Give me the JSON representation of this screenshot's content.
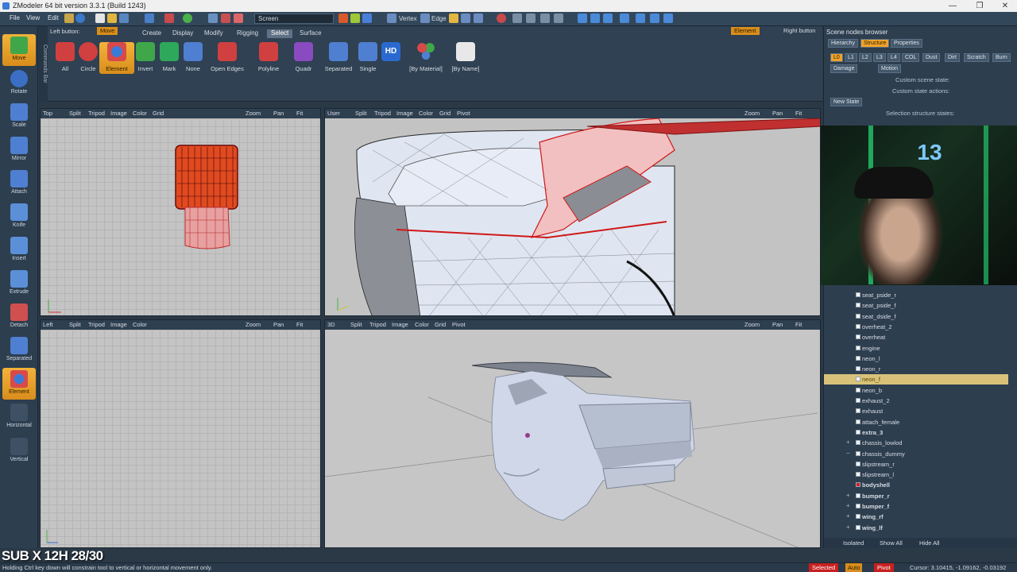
{
  "window": {
    "title": "ZModeler 64 bit version 3.3.1 (Build 1243)",
    "controls": [
      "—",
      "❐",
      "✕"
    ]
  },
  "menu": [
    "File",
    "View",
    "Edit"
  ],
  "toolbar": {
    "coord_mode": "Screen",
    "vertex": "Vertex",
    "edge": "Edge"
  },
  "left_tools": [
    "Move",
    "Rotate",
    "Scale",
    "Mirror",
    "Attach",
    "Knife",
    "Insert",
    "Extrude",
    "Detach",
    "Separated",
    "Element",
    "Horizontal",
    "Vertical"
  ],
  "left_tools_active": "Element",
  "commands_bar": "Commands Bar",
  "ribbon": {
    "left_button_label": "Left button:",
    "left_button_value": "Move",
    "tabs": [
      "Create",
      "Display",
      "Modify",
      "Rigging",
      "Select",
      "Surface"
    ],
    "selected_tab": "Select",
    "right_chip_value": "Element",
    "right_chip_label": "Right button",
    "buttons": [
      "All",
      "Circle",
      "Element",
      "Invert",
      "Mark",
      "None",
      "Open Edges",
      "Polyline",
      "Quadr",
      "Separated",
      "Single",
      "[By Material]",
      "[By Name]"
    ],
    "active_button": "Element"
  },
  "viewports": {
    "top": {
      "name": "Top",
      "tools": [
        "Split",
        "Tripod",
        "Image",
        "Color",
        "Grid"
      ],
      "nav": [
        "Zoom",
        "Pan",
        "Fit"
      ]
    },
    "user": {
      "name": "User",
      "tools": [
        "Split",
        "Tripod",
        "Image",
        "Color",
        "Grid",
        "Pivot"
      ],
      "nav": [
        "Zoom",
        "Pan",
        "Fit"
      ]
    },
    "left": {
      "name": "Left",
      "tools": [
        "Split",
        "Tripod",
        "Image",
        "Color"
      ],
      "nav": [
        "Zoom",
        "Pan",
        "Fit"
      ]
    },
    "three_d": {
      "name": "3D",
      "tools": [
        "Split",
        "Tripod",
        "Image",
        "Color",
        "Grid",
        "Pivot"
      ],
      "nav": [
        "Zoom",
        "Pan",
        "Fit"
      ]
    }
  },
  "panel": {
    "title": "Scene nodes browser",
    "tabs": [
      "Hierarchy",
      "Structure",
      "Properties"
    ],
    "selected_tab": "Structure",
    "lods": [
      "L0",
      "L1",
      "L2",
      "L3",
      "L4",
      "COL",
      "Dust",
      "Dirt",
      "Scratch",
      "Burn"
    ],
    "damage": "Damage",
    "motion": "Motion",
    "custom_scene_state": "Custom scene state:",
    "custom_state_actions": "Custom state actions:",
    "new_state": "New State",
    "selection_structure_states": "Selection structure states:",
    "nodes": [
      {
        "name": "seat_pside_r",
        "exp": "",
        "bold": false
      },
      {
        "name": "seat_pside_f",
        "exp": "",
        "bold": false
      },
      {
        "name": "seat_dside_f",
        "exp": "",
        "bold": false
      },
      {
        "name": "overheat_2",
        "exp": "",
        "bold": false
      },
      {
        "name": "overheat",
        "exp": "",
        "bold": false
      },
      {
        "name": "engine",
        "exp": "",
        "bold": false
      },
      {
        "name": "neon_l",
        "exp": "",
        "bold": false
      },
      {
        "name": "neon_r",
        "exp": "",
        "bold": false
      },
      {
        "name": "neon_f",
        "exp": "",
        "bold": false,
        "selected": true
      },
      {
        "name": "neon_b",
        "exp": "",
        "bold": false
      },
      {
        "name": "exhaust_2",
        "exp": "",
        "bold": false
      },
      {
        "name": "exhaust",
        "exp": "",
        "bold": false
      },
      {
        "name": "attach_female",
        "exp": "",
        "bold": false
      },
      {
        "name": "extra_3",
        "exp": "",
        "bold": true
      },
      {
        "name": "chassis_lowlod",
        "exp": "+",
        "bold": false
      },
      {
        "name": "chassis_dummy",
        "exp": "−",
        "bold": false
      },
      {
        "name": "slipstream_r",
        "exp": "",
        "bold": false
      },
      {
        "name": "slipstream_l",
        "exp": "",
        "bold": false
      },
      {
        "name": "bodyshell",
        "exp": "",
        "bold": true,
        "red": true
      },
      {
        "name": "bumper_r",
        "exp": "+",
        "bold": true
      },
      {
        "name": "bumper_f",
        "exp": "+",
        "bold": true
      },
      {
        "name": "wing_rf",
        "exp": "+",
        "bold": true
      },
      {
        "name": "wing_lf",
        "exp": "+",
        "bold": true
      }
    ],
    "footer": {
      "isolated": "Isolated",
      "show_all": "Show All",
      "hide_all": "Hide All"
    }
  },
  "status": {
    "hint": "Holding Ctrl key down will constrain tool to vertical or horizontal movement only.",
    "selected": "Selected",
    "auto": "Auto",
    "pivot": "Pivot",
    "cursor": "Cursor: 3.10415, -1.09162, -0.03192"
  },
  "stream_overlay": {
    "subtext": "SUB X 12H 28/30",
    "webcam_logo": "13"
  },
  "colors": {
    "accent": "#f0a32a",
    "selection_red": "#e02020",
    "mesh_blue": "#c9d6ea"
  }
}
